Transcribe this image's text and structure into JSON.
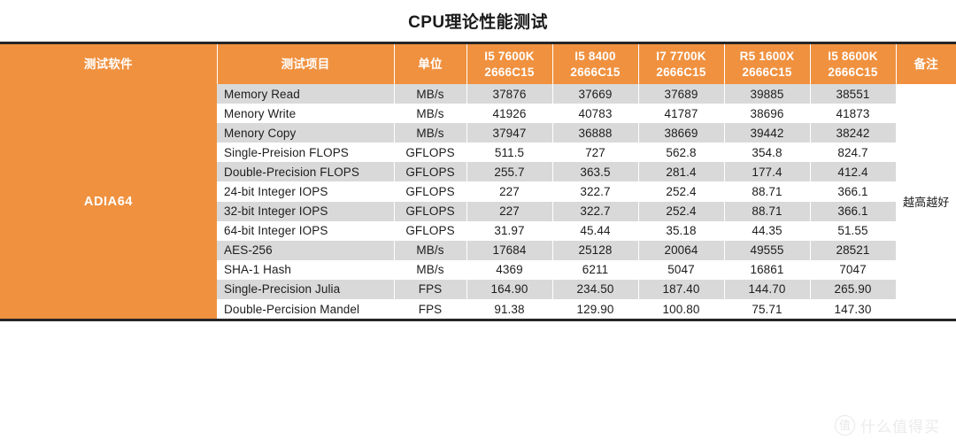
{
  "page": {
    "title": "CPU理论性能测试"
  },
  "colors": {
    "accent_orange": "#f0913f",
    "stripe_gray": "#d9d9d9",
    "border_dark": "#262626",
    "header_text": "#ffffff",
    "body_text": "#1d1d1d",
    "watermark_gray": "#ebebeb"
  },
  "table": {
    "headers": {
      "software": "测试软件",
      "item": "测试项目",
      "unit": "单位",
      "note": "备注"
    },
    "cpu_columns": [
      {
        "name": "I5 7600K",
        "memory": "2666C15"
      },
      {
        "name": "I5 8400",
        "memory": "2666C15"
      },
      {
        "name": "I7 7700K",
        "memory": "2666C15"
      },
      {
        "name": "R5 1600X",
        "memory": "2666C15"
      },
      {
        "name": "I5 8600K",
        "memory": "2666C15"
      }
    ],
    "software_label": "ADIA64",
    "note_label": "越高越好",
    "rows": [
      {
        "item": "Memory Read",
        "unit": "MB/s",
        "values": [
          "37876",
          "37669",
          "37689",
          "39885",
          "38551"
        ]
      },
      {
        "item": "Menory Write",
        "unit": "MB/s",
        "values": [
          "41926",
          "40783",
          "41787",
          "38696",
          "41873"
        ]
      },
      {
        "item": "Menory Copy",
        "unit": "MB/s",
        "values": [
          "37947",
          "36888",
          "38669",
          "39442",
          "38242"
        ]
      },
      {
        "item": "Single-Preision FLOPS",
        "unit": "GFLOPS",
        "values": [
          "511.5",
          "727",
          "562.8",
          "354.8",
          "824.7"
        ]
      },
      {
        "item": "Double-Precision FLOPS",
        "unit": "GFLOPS",
        "values": [
          "255.7",
          "363.5",
          "281.4",
          "177.4",
          "412.4"
        ]
      },
      {
        "item": "24-bit Integer IOPS",
        "unit": "GFLOPS",
        "values": [
          "227",
          "322.7",
          "252.4",
          "88.71",
          "366.1"
        ]
      },
      {
        "item": "32-bit Integer IOPS",
        "unit": "GFLOPS",
        "values": [
          "227",
          "322.7",
          "252.4",
          "88.71",
          "366.1"
        ]
      },
      {
        "item": "64-bit Integer IOPS",
        "unit": "GFLOPS",
        "values": [
          "31.97",
          "45.44",
          "35.18",
          "44.35",
          "51.55"
        ]
      },
      {
        "item": "AES-256",
        "unit": "MB/s",
        "values": [
          "17684",
          "25128",
          "20064",
          "49555",
          "28521"
        ]
      },
      {
        "item": "SHA-1 Hash",
        "unit": "MB/s",
        "values": [
          "4369",
          "6211",
          "5047",
          "16861",
          "7047"
        ]
      },
      {
        "item": "Single-Precision Julia",
        "unit": "FPS",
        "values": [
          "164.90",
          "234.50",
          "187.40",
          "144.70",
          "265.90"
        ]
      },
      {
        "item": "Double-Percision Mandel",
        "unit": "FPS",
        "values": [
          "91.38",
          "129.90",
          "100.80",
          "75.71",
          "147.30"
        ]
      }
    ]
  },
  "watermark": {
    "badge": "值",
    "text": "什么值得买"
  }
}
